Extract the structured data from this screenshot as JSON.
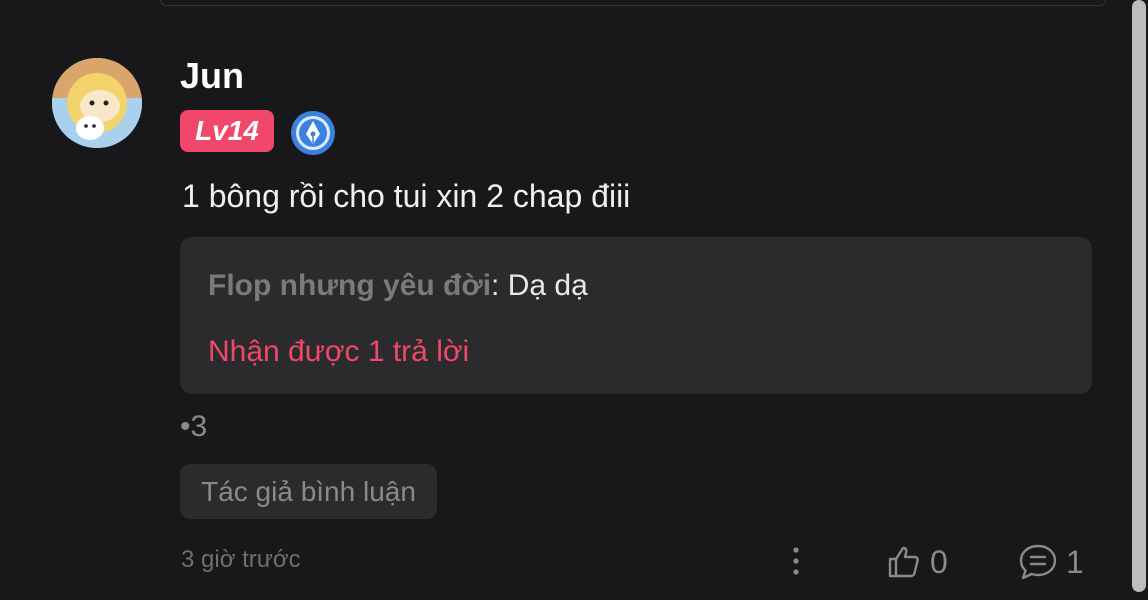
{
  "comment": {
    "username": "Jun",
    "level": "Lv14",
    "text": "1 bông rồi cho tui xin 2 chap điii",
    "bullet_count": "•3",
    "author_tag": "Tác giả bình luận",
    "timestamp": "3 giờ trước",
    "like_count": "0",
    "reply_count": "1"
  },
  "reply_preview": {
    "author": "Flop nhưng yêu đời",
    "separator": ":",
    "text": " Dạ dạ",
    "replies_label": "Nhận được 1 trả lời"
  },
  "colors": {
    "background": "#18181a",
    "accent_pink": "#f0476a",
    "badge_blue": "#3b82e0",
    "muted": "#8a8a8c"
  },
  "icons": [
    "avatar-image",
    "pen-badge-icon",
    "more-options-icon",
    "thumbs-up-icon",
    "comment-icon"
  ]
}
